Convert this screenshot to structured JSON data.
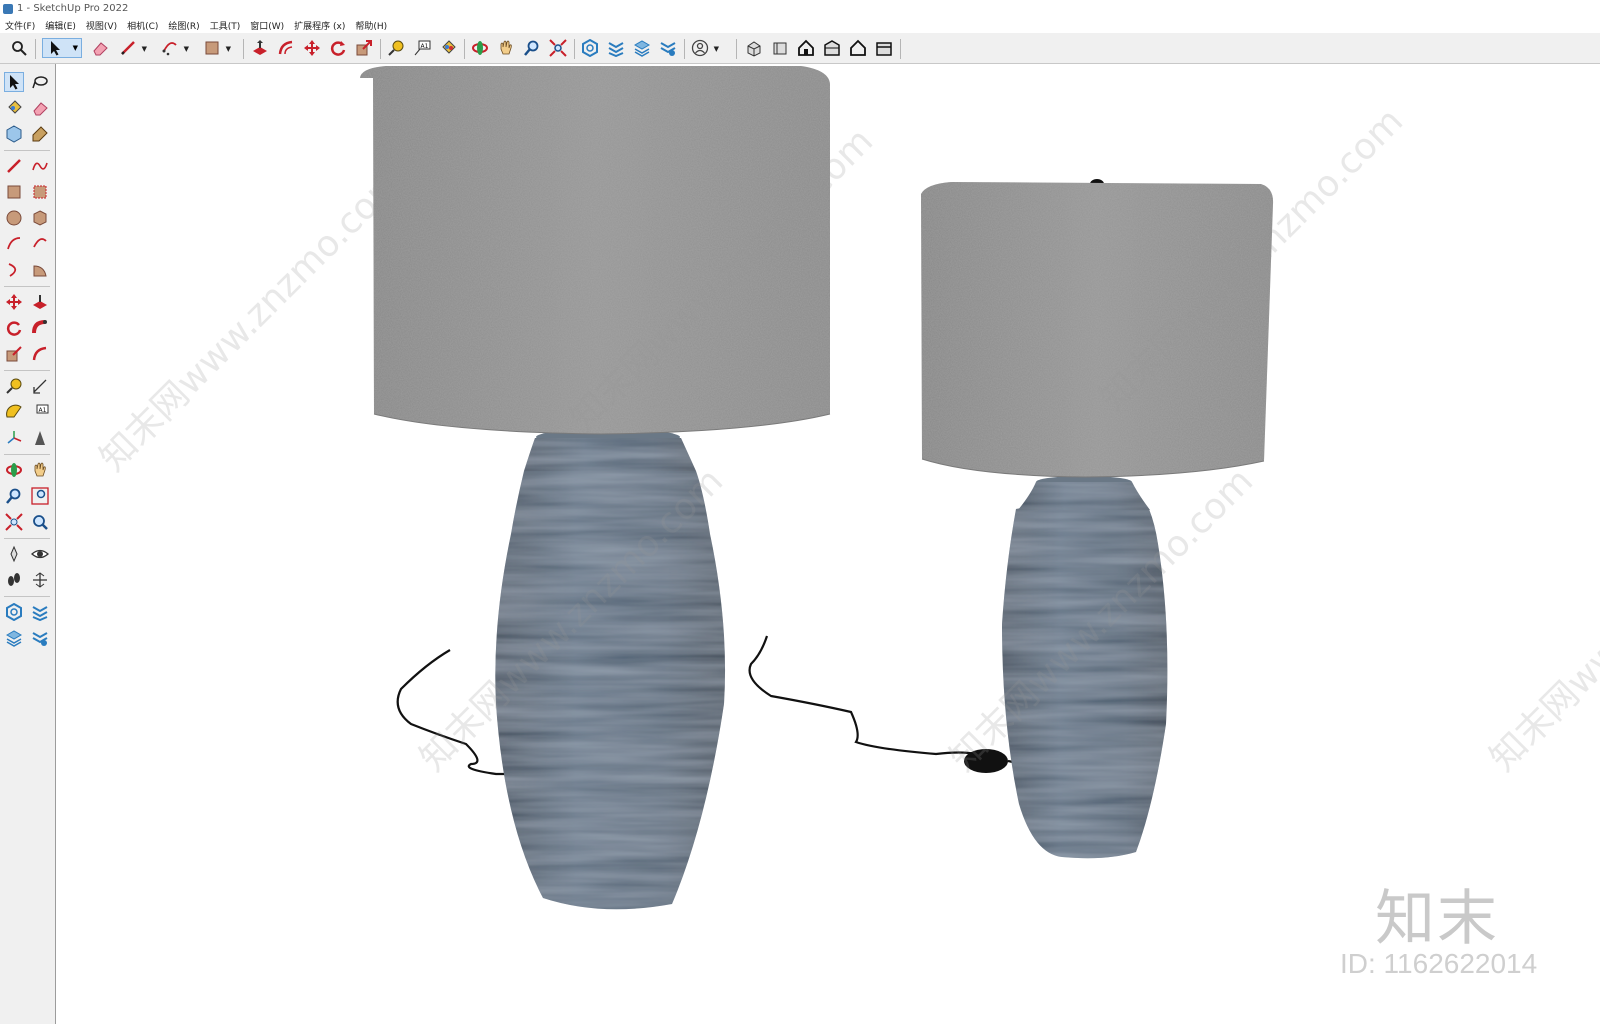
{
  "window": {
    "title": "1 - SketchUp Pro 2022"
  },
  "menu": [
    "文件(F)",
    "编辑(E)",
    "视图(V)",
    "相机(C)",
    "绘图(R)",
    "工具(T)",
    "窗口(W)",
    "扩展程序 (x)",
    "帮助(H)"
  ],
  "watermark": {
    "logo": "知末",
    "id": "ID: 1162622014",
    "url": "知末网www.znzmo.com"
  },
  "colors": {
    "toolbar_bg": "#f0f0f0",
    "shade": "#8f8f8f",
    "vase": "#4e5e6e",
    "accent_red": "#c8202a",
    "accent_blue": "#2a7cbf"
  }
}
